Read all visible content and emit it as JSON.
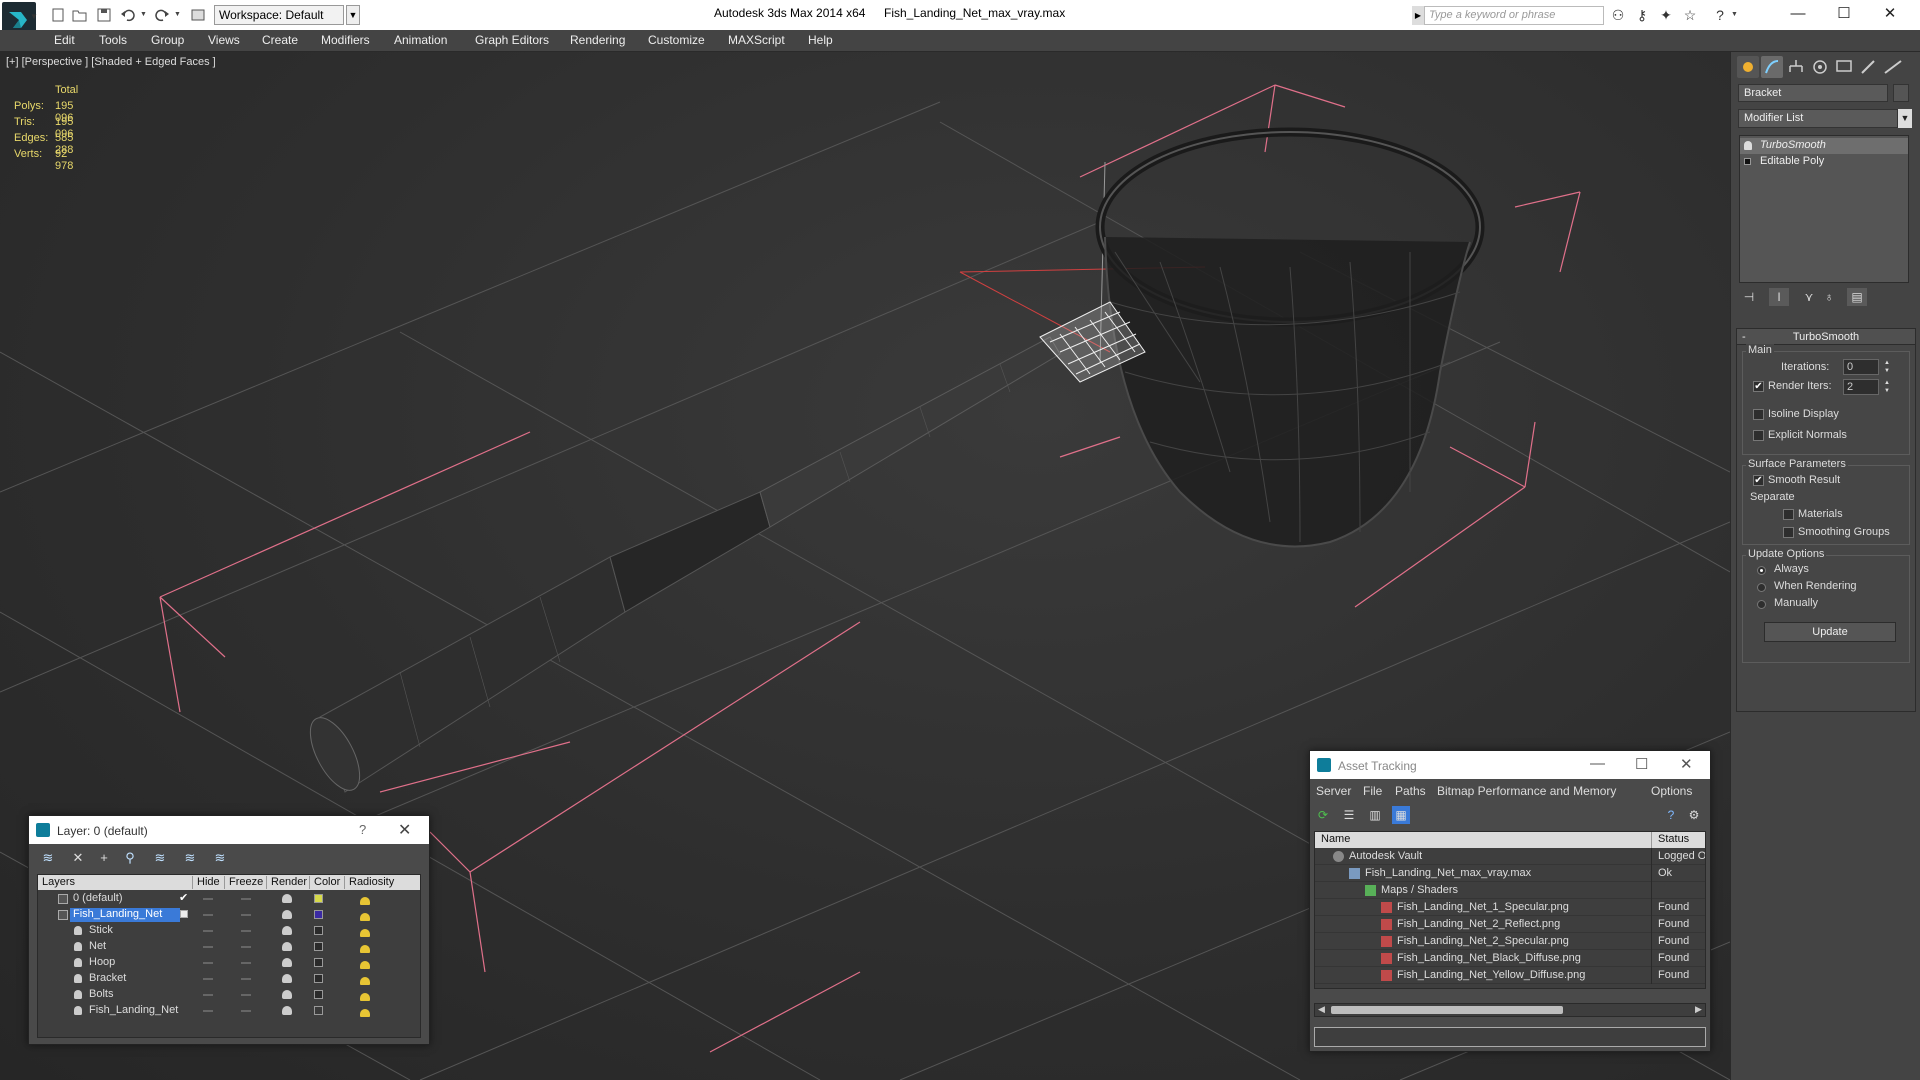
{
  "titlebar": {
    "workspace": "Workspace: Default",
    "app_title": "Autodesk 3ds Max  2014 x64",
    "file_title": "Fish_Landing_Net_max_vray.max",
    "search_placeholder": "Type a keyword or phrase",
    "icons": [
      "new-file-icon",
      "open-icon",
      "save-icon",
      "undo-icon",
      "redo-icon",
      "binoculars-icon",
      "key-icon",
      "satellite-icon",
      "star-icon",
      "help-icon"
    ],
    "window_controls": {
      "minimize": "—",
      "maximize": "☐",
      "close": "✕"
    }
  },
  "menu": [
    "Edit",
    "Tools",
    "Group",
    "Views",
    "Create",
    "Modifiers",
    "Animation",
    "Graph Editors",
    "Rendering",
    "Customize",
    "MAXScript",
    "Help"
  ],
  "viewport": {
    "label": "[+] [Perspective ] [Shaded + Edged Faces ]",
    "stats": {
      "header": "Total",
      "rows": [
        {
          "label": "Polys:",
          "value": "195 096"
        },
        {
          "label": "Tris:",
          "value": "195 096"
        },
        {
          "label": "Edges:",
          "value": "585 288"
        },
        {
          "label": "Verts:",
          "value": "92 978"
        }
      ]
    },
    "colors": {
      "grid": "#555555",
      "bbox": "#e0708a",
      "axis": "#d04040"
    }
  },
  "command_panel": {
    "tabs": [
      "create-icon",
      "modify-icon",
      "hierarchy-icon",
      "motion-icon",
      "display-icon",
      "utilities-icon"
    ],
    "object_name": "Bracket",
    "modifier_list": "Modifier List",
    "stack": [
      {
        "label": "TurboSmooth"
      },
      {
        "label": "Editable Poly"
      }
    ],
    "turbosmooth": {
      "title": "TurboSmooth",
      "collapse": "-",
      "main_label": "Main",
      "iterations_label": "Iterations:",
      "iterations_value": "0",
      "render_iters_label": "Render Iters:",
      "render_iters_value": "2",
      "render_iters_checked": "✔",
      "isoline_label": "Isoline Display",
      "explicit_normals_label": "Explicit Normals",
      "surface_params_label": "Surface Parameters",
      "smooth_result_label": "Smooth Result",
      "smooth_result_checked": "✔",
      "separate_label": "Separate",
      "materials_label": "Materials",
      "smoothing_groups_label": "Smoothing Groups",
      "update_options_label": "Update Options",
      "always_label": "Always",
      "when_rendering_label": "When Rendering",
      "manually_label": "Manually",
      "update_button": "Update"
    }
  },
  "layer_window": {
    "title": "Layer: 0 (default)",
    "help": "?",
    "close": "✕",
    "toolbar": [
      "create-layer-icon",
      "delete-layer-icon",
      "add-to-layer-icon",
      "select-in-layer-icon",
      "highlight-layer-icon",
      "hide-all-icon",
      "freeze-all-icon"
    ],
    "columns": [
      "Layers",
      "Hide",
      "Freeze",
      "Render",
      "Color",
      "Radiosity"
    ],
    "rows": [
      {
        "name": "0 (default)",
        "color": "#d6d94a",
        "checked": "✔"
      },
      {
        "name": "Fish_Landing_Net",
        "color": "#3b2aa3"
      },
      {
        "name": "Stick",
        "color": "#2a2a2a"
      },
      {
        "name": "Net",
        "color": "#2a2a2a"
      },
      {
        "name": "Hoop",
        "color": "#2a2a2a"
      },
      {
        "name": "Bracket",
        "color": "#2a2a2a"
      },
      {
        "name": "Bolts",
        "color": "#2a2a2a"
      },
      {
        "name": "Fish_Landing_Net",
        "color": "#3a3a3a"
      }
    ]
  },
  "asset_window": {
    "title": "Asset Tracking",
    "controls": {
      "minimize": "—",
      "maximize": "☐",
      "close": "✕"
    },
    "menu": [
      "Server",
      "File",
      "Paths",
      "Bitmap Performance and Memory",
      "Options"
    ],
    "columns": {
      "name": "Name",
      "status": "Status"
    },
    "rows": [
      {
        "name": "Autodesk Vault",
        "status": "Logged Ou"
      },
      {
        "name": "Fish_Landing_Net_max_vray.max",
        "status": "Ok"
      },
      {
        "name": "Maps / Shaders",
        "status": ""
      },
      {
        "name": "Fish_Landing_Net_1_Specular.png",
        "status": "Found"
      },
      {
        "name": "Fish_Landing_Net_2_Reflect.png",
        "status": "Found"
      },
      {
        "name": "Fish_Landing_Net_2_Specular.png",
        "status": "Found"
      },
      {
        "name": "Fish_Landing_Net_Black_Diffuse.png",
        "status": "Found"
      },
      {
        "name": "Fish_Landing_Net_Yellow_Diffuse.png",
        "status": "Found"
      }
    ]
  }
}
